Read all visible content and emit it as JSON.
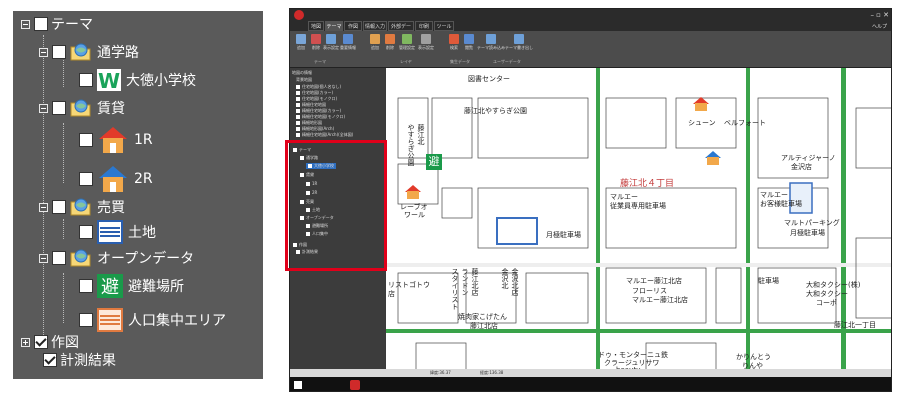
{
  "zoom_tree": {
    "root": {
      "label": "テーマ"
    },
    "items": [
      {
        "label": "通学路"
      },
      {
        "label": "大徳小学校"
      },
      {
        "label": "賃貸"
      },
      {
        "label": "1R"
      },
      {
        "label": "2R"
      },
      {
        "label": "売買"
      },
      {
        "label": "土地"
      },
      {
        "label": "オープンデータ"
      },
      {
        "label": "避難場所"
      },
      {
        "label": "人口集中エリア"
      },
      {
        "label": "作図"
      },
      {
        "label": "計測結果"
      }
    ],
    "icon_text": {
      "school": "W",
      "evac": "避"
    }
  },
  "app": {
    "tabs": [
      "地図",
      "テーマ",
      "作図",
      "情報入力",
      "外部データ",
      "印刷",
      "ツール"
    ],
    "help": "ヘルプ",
    "ribbon_buttons": [
      "追加",
      "削除",
      "表示設定",
      "重要情報",
      "追加",
      "削除",
      "管理設定",
      "表示設定",
      "検索",
      "閲覧",
      "テーマ読み込み",
      "テーマ書き出し"
    ],
    "ribbon_groups": [
      "テーマ",
      "レイヤ",
      "集生データ",
      "ユーザーデータ"
    ],
    "side_items": [
      "地図の情報",
      "背景地図",
      "住宅地図(個人名なし)",
      "住宅地図(カラー)",
      "住宅地図(モノクロ)",
      "精細住宅地図",
      "精細住宅地図(カラー)",
      "精細住宅地図(モノクロ)",
      "精細地形図",
      "精細地形図(Arch)",
      "精細住宅地図(Arch)(全体図)"
    ],
    "side_tree": [
      "テーマ",
      "通学路",
      "大徳小学校",
      "賃貸",
      "1R",
      "2R",
      "売買",
      "土地",
      "オープンデータ",
      "避難場所",
      "人口集中",
      "作図",
      "計測結果"
    ],
    "map_labels": [
      "図書センター",
      "藤江北やすらぎ公園",
      "やすらぎ公園",
      "藤江北",
      "シューン",
      "ベルフォート",
      "アルティジャーノ",
      "金沢店",
      "藤江北４丁目",
      "レーブオ",
      "ワール",
      "マルエー",
      "従業員専用駐車場",
      "マルエー",
      "お客様駐車場",
      "マルトパーキング",
      "月極駐車場",
      "月極駐車場",
      "リストゴトウ",
      "店",
      "スタイリスト",
      "ランドン",
      "藤江北店",
      "金沢北",
      "金沢北店",
      "焼肉家こげたん",
      "藤江北店",
      "マルエー藤江北店",
      "フローリス",
      "マルエー藤江北店",
      "駐車場",
      "大和タクシー(株)",
      "大和タクシー",
      "コーポ",
      "ドゥ・モンターニュ鉄",
      "クラージュリサワ",
      "beauty",
      "かりんとう",
      "りんや",
      "藤江北一丁目"
    ],
    "status": [
      "緯度:36.37",
      "経度:136.38"
    ],
    "evac_icon": "避",
    "colors": {
      "road_green": "#3aa34a",
      "map_accent": "#c33b3b"
    }
  }
}
